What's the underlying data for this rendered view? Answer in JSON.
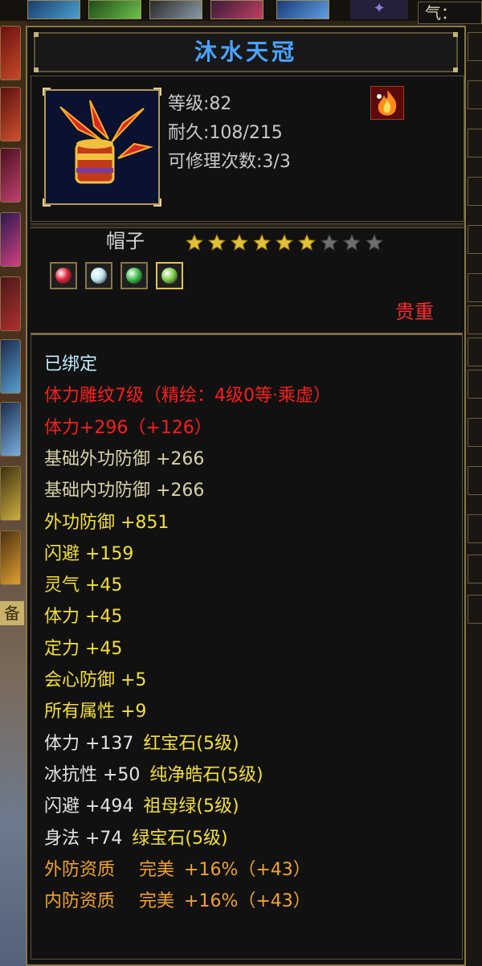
{
  "window": {
    "qi_label": "气："
  },
  "item": {
    "name": "沐水天冠",
    "level": "等级:82",
    "durability": "耐久:108/215",
    "repairs": "可修理次数:3/3",
    "type": "帽子",
    "stars_filled": 6,
    "stars_total": 9,
    "rarity": "贵重",
    "gems": [
      {
        "icon": "ruby-gem-icon",
        "color": "#e0243a"
      },
      {
        "icon": "pure-moonstone-gem-icon",
        "color": "#bfe6f2"
      },
      {
        "icon": "emerald-gem-icon",
        "color": "#3fbf4a"
      },
      {
        "icon": "green-sapphire-gem-icon",
        "color": "#7fd04a"
      }
    ]
  },
  "properties": [
    {
      "text": "已绑定",
      "color": "cyan"
    },
    {
      "text": "体力雕纹7级（精绘：4级0等·乘虚）",
      "color": "red"
    },
    {
      "text": "体力+296（+126）",
      "color": "red"
    },
    {
      "text": "基础外功防御 +266",
      "color": "khaki"
    },
    {
      "text": "基础内功防御 +266",
      "color": "khaki"
    },
    {
      "text": "外功防御 +851",
      "color": "yellow"
    },
    {
      "text": "闪避 +159",
      "color": "yellow"
    },
    {
      "text": "灵气 +45",
      "color": "yellow"
    },
    {
      "text": "体力 +45",
      "color": "yellow"
    },
    {
      "text": "定力 +45",
      "color": "yellow"
    },
    {
      "text": "会心防御 +5",
      "color": "yellow"
    },
    {
      "text": "所有属性 +9",
      "color": "yellow"
    }
  ],
  "gem_properties": [
    {
      "stat": "体力 +137",
      "gem": "红宝石(5级)"
    },
    {
      "stat": "冰抗性 +50",
      "gem": "纯净皓石(5级)"
    },
    {
      "stat": "闪避 +494",
      "gem": "祖母绿(5级)"
    },
    {
      "stat": "身法 +74",
      "gem": "绿宝石(5级)"
    }
  ],
  "aptitudes": [
    {
      "name": "外防资质",
      "grade": "完美",
      "value": "+16%（+43）"
    },
    {
      "name": "内防资质",
      "grade": "完美",
      "value": "+16%（+43）"
    }
  ]
}
